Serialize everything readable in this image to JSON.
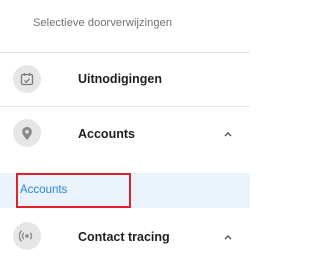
{
  "nav": {
    "section_header": "Selectieve doorverwijzingen",
    "items": [
      {
        "label": "Uitnodigingen",
        "icon": "calendar-check-icon",
        "expanded": null
      },
      {
        "label": "Accounts",
        "icon": "location-pin-icon",
        "expanded": true,
        "children": [
          {
            "label": "Accounts",
            "active": true
          }
        ]
      },
      {
        "label": "Contact tracing",
        "icon": "signal-waves-icon",
        "expanded": true
      }
    ]
  },
  "colors": {
    "active_text": "#2a86d6",
    "active_bg": "#eaf3fb",
    "highlight": "#e0222a"
  }
}
